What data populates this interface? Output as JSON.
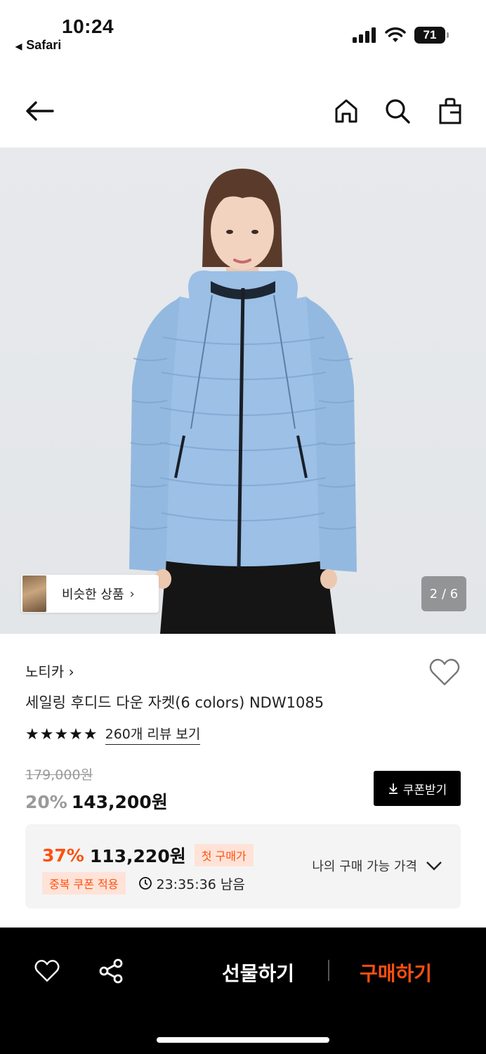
{
  "status_bar": {
    "time": "10:24",
    "back_app": "Safari",
    "battery": "71"
  },
  "nav": {
    "back_icon": "arrow-left-icon",
    "home_icon": "home-icon",
    "search_icon": "search-icon",
    "bag_icon": "shopping-bag-icon"
  },
  "gallery": {
    "similar_label": "비슷한 상품",
    "pager": "2 / 6"
  },
  "product": {
    "brand": "노티카",
    "name": "세일링 후디드 다운 자켓(6 colors) NDW1085",
    "stars": "★★★★★",
    "reviews_label": "260개 리뷰 보기",
    "original_price": "179,000원",
    "discount": "20%",
    "price": "143,200원",
    "coupon_button": "쿠폰받기"
  },
  "best_price": {
    "discount": "37%",
    "price": "113,220원",
    "first_purchase_badge": "첫 구매가",
    "coupon_badge": "중복 쿠폰 적용",
    "timer": "23:35:36 남음",
    "my_price_label": "나의 구매 가능 가격"
  },
  "bottom_bar": {
    "gift_label": "선물하기",
    "buy_label": "구매하기"
  },
  "colors": {
    "accent": "#ff4f0f",
    "jacket": "#9cc0e6",
    "background": "#e6e8eb"
  }
}
